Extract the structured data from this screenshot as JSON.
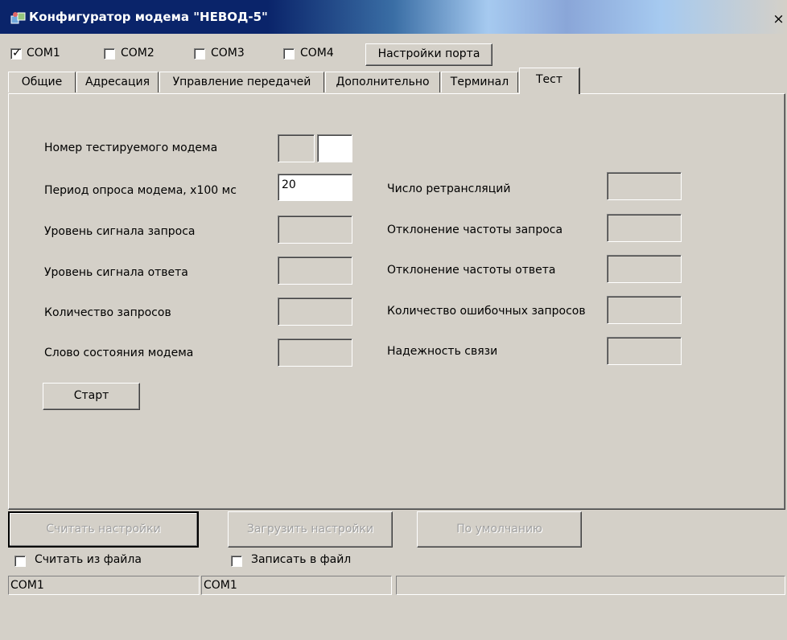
{
  "window": {
    "title": "Конфигуратор модема \"НЕВОД-5\"",
    "close": "×"
  },
  "ports": [
    {
      "label": "COM1",
      "checked": true
    },
    {
      "label": "COM2",
      "checked": false
    },
    {
      "label": "COM3",
      "checked": false
    },
    {
      "label": "COM4",
      "checked": false
    }
  ],
  "port_settings_button": "Настройки порта",
  "tabs": [
    {
      "label": "Общие"
    },
    {
      "label": "Адресация"
    },
    {
      "label": "Управление передачей"
    },
    {
      "label": "Дополнительно"
    },
    {
      "label": "Терминал"
    },
    {
      "label": "Тест",
      "active": true
    }
  ],
  "test": {
    "modem_number_label": "Номер тестируемого модема",
    "poll_period_label": "Период опроса модема, x100 мс",
    "poll_period_value": "20",
    "request_level_label": "Уровень сигнала запроса",
    "response_level_label": "Уровень сигнала ответа",
    "requests_count_label": "Количество запросов",
    "status_word_label": "Слово состояния модема",
    "retranslations_label": "Число ретрансляций",
    "request_freq_dev_label": "Отклонение частоты запроса",
    "response_freq_dev_label": "Отклонение частоты ответа",
    "error_requests_label": "Количество ошибочных запросов",
    "reliability_label": "Надежность связи",
    "start_button": "Старт"
  },
  "actions": {
    "read_settings": "Считать настройки",
    "load_settings": "Загрузить настройки",
    "defaults": "По умолчанию",
    "read_from_file": "Считать из файла",
    "write_to_file": "Записать в файл"
  },
  "status_bar": {
    "cell1": "COM1",
    "cell2": "COM1",
    "cell3": ""
  }
}
